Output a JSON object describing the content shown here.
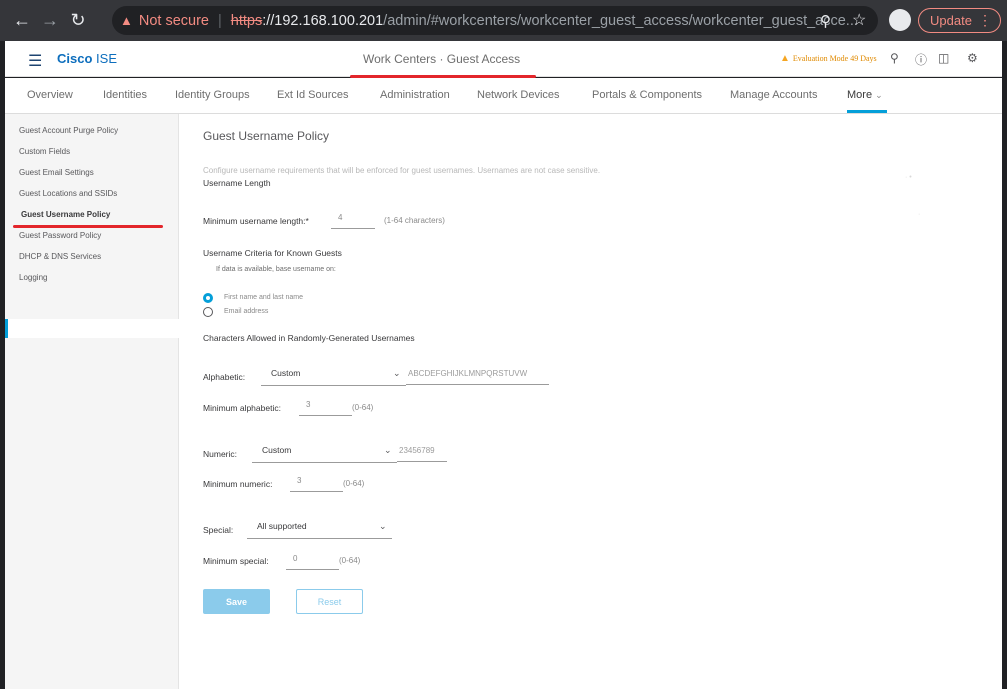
{
  "browser": {
    "security_label": "Not secure",
    "url_scheme": "https",
    "url_host": "://192.168.100.201",
    "url_path": "/admin/#workcenters/workcenter_guest_access/workcenter_guest_acce...",
    "update_label": "Update"
  },
  "header": {
    "brand_cisco": "Cisco",
    "brand_product": "ISE",
    "title": "Work Centers · Guest Access",
    "evaluation": "Evaluation Mode 49 Days"
  },
  "tabs": {
    "overview": "Overview",
    "identities": "Identities",
    "identity_groups": "Identity Groups",
    "ext_id_sources": "Ext Id Sources",
    "administration": "Administration",
    "network_devices": "Network Devices",
    "portals_components": "Portals & Components",
    "manage_accounts": "Manage Accounts",
    "more": "More"
  },
  "sidebar": {
    "items": [
      {
        "label": "Guest Account Purge Policy"
      },
      {
        "label": "Custom Fields"
      },
      {
        "label": "Guest Email Settings"
      },
      {
        "label": "Guest Locations and SSIDs"
      },
      {
        "label": "Guest Username Policy"
      },
      {
        "label": "Guest Password Policy"
      },
      {
        "label": "DHCP & DNS Services"
      },
      {
        "label": "Logging"
      }
    ]
  },
  "main": {
    "title": "Guest Username Policy",
    "description": "Configure username requirements that will be enforced for guest usernames. Usernames are not case sensitive.",
    "username_length": {
      "heading": "Username Length",
      "min_label": "Minimum username length:*",
      "min_value": "4",
      "min_hint": "(1-64 characters)"
    },
    "known_guests": {
      "heading": "Username Criteria for Known Guests",
      "subtext": "If data is available, base username on:",
      "option_first_last": "First name and last name",
      "option_email": "Email address",
      "selected": "First name and last name"
    },
    "random": {
      "heading": "Characters Allowed in Randomly-Generated Usernames",
      "alphabetic_label": "Alphabetic:",
      "alphabetic_select": "Custom",
      "alphabetic_chars": "ABCDEFGHIJKLMNPQRSTUVW",
      "min_alpha_label": "Minimum alphabetic:",
      "min_alpha_value": "3",
      "min_alpha_hint": "(0-64)",
      "numeric_label": "Numeric:",
      "numeric_select": "Custom",
      "numeric_chars": "23456789",
      "min_num_label": "Minimum numeric:",
      "min_num_value": "3",
      "min_num_hint": "(0-64)",
      "special_label": "Special:",
      "special_select": "All supported",
      "min_special_label": "Minimum special:",
      "min_special_value": "0",
      "min_special_hint": "(0-64)"
    },
    "save_label": "Save",
    "reset_label": "Reset"
  },
  "colors": {
    "accent": "#049fd9",
    "annotation_red": "#e3262b",
    "brand": "#0d6ebd",
    "warning": "#f5a623"
  }
}
